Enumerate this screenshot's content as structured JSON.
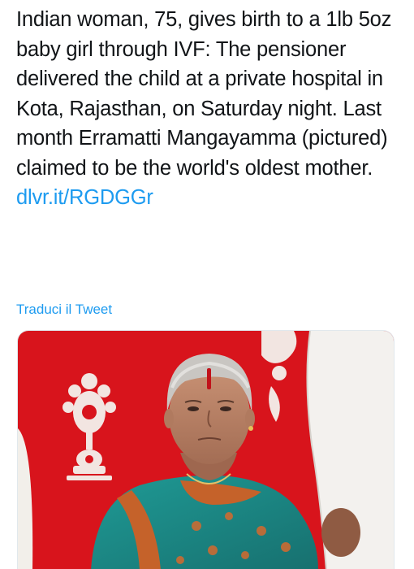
{
  "tweet": {
    "text": "Indian woman, 75, gives birth to a 1lb 5oz baby girl through IVF: The pensioner delivered the child at a private hospital in Kota, Rajasthan, on Saturday night. Last month Erramatti Mangayamma (pictured) claimed to be the world's oldest mother.",
    "link_text": "dlvr.it/RGDGGr",
    "translate_label": "Traduci il Tweet"
  },
  "media": {
    "icon": "photo-elderly-woman-in-saree",
    "colors": {
      "background": "#d8141c",
      "ornament": "#f4f1ec",
      "saree_teal": "#1f8c8a",
      "saree_border": "#c5622a",
      "link": "#1d9bf0"
    }
  }
}
